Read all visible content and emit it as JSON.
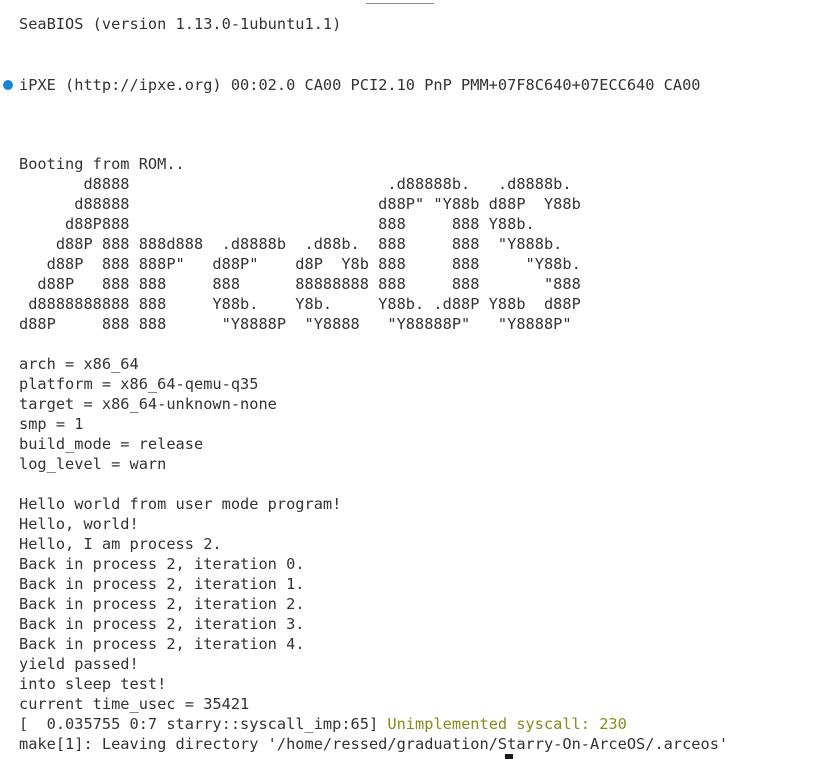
{
  "bios": {
    "line": "SeaBIOS (version 1.13.0-1ubuntu1.1)"
  },
  "ipxe": {
    "line": "iPXE (http://ipxe.org) 00:02.0 CA00 PCI2.10 PnP PMM+07F8C640+07ECC640 CA00"
  },
  "boot": {
    "line": "Booting from ROM.."
  },
  "logo": [
    "       d8888                            .d88888b.   .d8888b.",
    "      d88888                           d88P\" \"Y88b d88P  Y88b",
    "     d88P888                           888     888 Y88b.",
    "    d88P 888 888d888  .d8888b  .d88b.  888     888  \"Y888b.",
    "   d88P  888 888P\"   d88P\"    d8P  Y8b 888     888     \"Y88b.",
    "  d88P   888 888     888      88888888 888     888       \"888",
    " d8888888888 888     Y88b.    Y8b.     Y88b. .d88P Y88b  d88P",
    "d88P     888 888      \"Y8888P  \"Y8888   \"Y88888P\"   \"Y8888P\""
  ],
  "config": [
    "arch = x86_64",
    "platform = x86_64-qemu-q35",
    "target = x86_64-unknown-none",
    "smp = 1",
    "build_mode = release",
    "log_level = warn"
  ],
  "output": [
    "Hello world from user mode program!",
    "Hello, world!",
    "Hello, I am process 2.",
    "Back in process 2, iteration 0.",
    "Back in process 2, iteration 1.",
    "Back in process 2, iteration 2.",
    "Back in process 2, iteration 3.",
    "Back in process 2, iteration 4.",
    "yield passed!",
    "into sleep test!",
    "current time_usec = 35421"
  ],
  "log": {
    "prefix": "[  0.035755 0:7 starry::syscall_imp:65] ",
    "message": "Unimplemented syscall: 230"
  },
  "make_line": "make[1]: Leaving directory '/home/ressed/graduation/Starry-On-ArceOS/.arceos'",
  "colors": {
    "text": "#333333",
    "warn": "#8a8a1c",
    "dot": "#1a85d6",
    "background": "#ffffff"
  }
}
